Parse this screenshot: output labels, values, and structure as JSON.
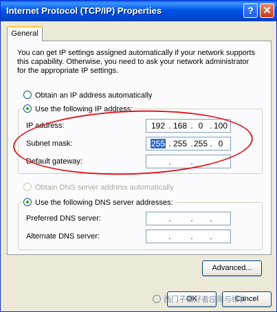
{
  "window": {
    "title": "Internet Protocol (TCP/IP) Properties",
    "help_glyph": "?",
    "close_glyph": "✕"
  },
  "tabs": [
    {
      "label": "General"
    }
  ],
  "intro_text": "You can get IP settings assigned automatically if your network supports this capability. Otherwise, you need to ask your network administrator for the appropriate IP settings.",
  "ip_mode": {
    "auto_label": "Obtain an IP address automatically",
    "manual_label": "Use the following IP address:",
    "selected": "manual"
  },
  "ip_fields": [
    {
      "label": "IP address:",
      "octets": [
        "192",
        "168",
        "0",
        "100"
      ]
    },
    {
      "label": "Subnet mask:",
      "octets": [
        "255",
        "255",
        "255",
        "0"
      ],
      "selected_octet": 0
    },
    {
      "label": "Default gateway:",
      "octets": [
        "",
        "",
        "",
        ""
      ]
    }
  ],
  "dns_mode": {
    "auto_label": "Obtain DNS server address automatically",
    "manual_label": "Use the following DNS server addresses:",
    "selected": "manual",
    "auto_disabled": true
  },
  "dns_fields": [
    {
      "label": "Preferred DNS server:",
      "octets": [
        "",
        "",
        "",
        ""
      ]
    },
    {
      "label": "Alternate DNS server:",
      "octets": [
        "",
        "",
        "",
        ""
      ]
    }
  ],
  "buttons": {
    "advanced": "Advanced...",
    "ok": "OK",
    "cancel": "Cancel"
  },
  "watermark": "西门子爱好者应用与维护",
  "colors": {
    "title_bar": "#0055E5",
    "annotation_ellipse": "#E2151C",
    "selection": "#316AC5"
  }
}
